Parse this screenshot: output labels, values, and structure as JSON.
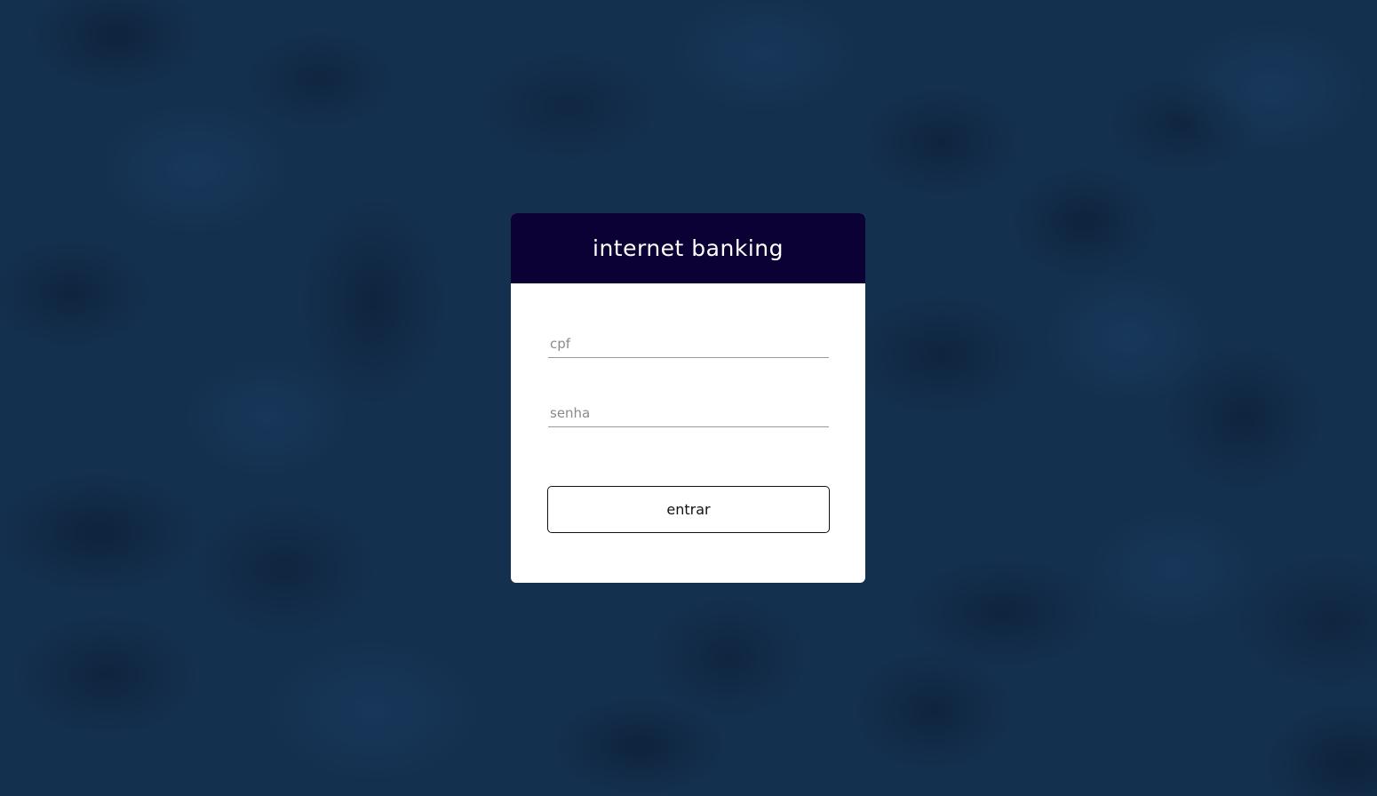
{
  "login": {
    "title": "internet banking",
    "cpf_placeholder": "cpf",
    "cpf_value": "",
    "password_placeholder": "senha",
    "password_value": "",
    "submit_label": "entrar"
  },
  "colors": {
    "background": "#14304f",
    "header": "#0b0134",
    "card": "#ffffff",
    "button_border": "#111111"
  }
}
